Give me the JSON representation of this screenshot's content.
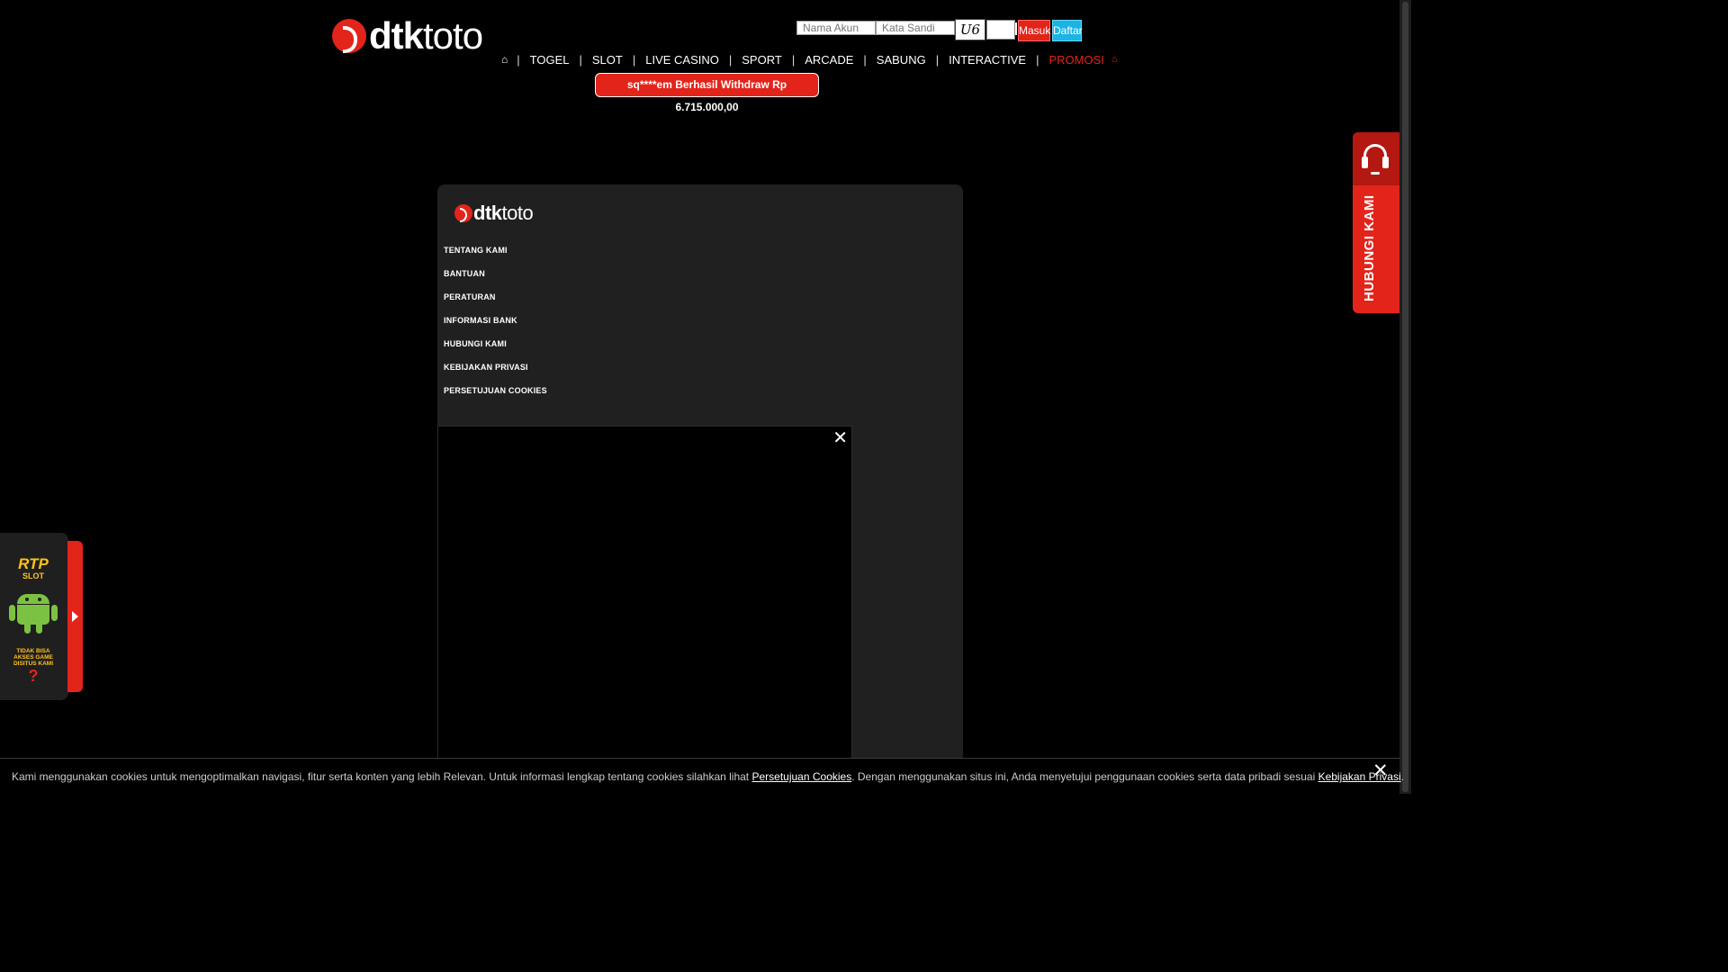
{
  "brand": {
    "logo_bold": "dtk",
    "logo_thin": "toto",
    "accent": "#e3241b",
    "secondary": "#1bb4e3"
  },
  "login": {
    "username_placeholder": "Nama Akun",
    "password_placeholder": "Kata Sandi",
    "captcha_text": "U6",
    "login_label": "Masuk",
    "register_label": "Daftar"
  },
  "nav": {
    "home_icon": "home-icon",
    "items": [
      "TOGEL",
      "SLOT",
      "LIVE CASINO",
      "SPORT",
      "ARCADE",
      "SABUNG",
      "INTERACTIVE"
    ],
    "promo_label": "PROMOSI",
    "promo_icon": "gift-icon"
  },
  "ticker": {
    "text": "sq****em Berhasil Withdraw Rp 6.715.000,00"
  },
  "footer": {
    "links": [
      "TENTANG KAMI",
      "BANTUAN",
      "PERATURAN",
      "INFORMASI BANK",
      "HUBUNGI KAMI",
      "KEBIJAKAN PRIVASI",
      "PERSETUJUAN COOKIES"
    ]
  },
  "contact_tab": {
    "label": "HUBUNGI KAMI",
    "icon": "headset-icon"
  },
  "side_panel": {
    "rtp_line1": "RTP",
    "rtp_line2": "SLOT",
    "android_icon": "android-icon",
    "warning_text": "TIDAK BISA AKSES GAME DISITUS KAMI",
    "warning_mark": "?"
  },
  "cookie_bar": {
    "text_before": "Kami menggunakan cookies untuk mengoptimalkan navigasi, fitur serta konten yang lebih Relevan. Untuk informasi lengkap tentang cookies silahkan lihat ",
    "link1": "Persetujuan Cookies",
    "text_middle": ". Dengan menggunakan situs ini, Anda menyetujui penggunaan cookies serta data pribadi sesuai ",
    "link2": "Kebijakan Privasi",
    "text_after": "."
  }
}
